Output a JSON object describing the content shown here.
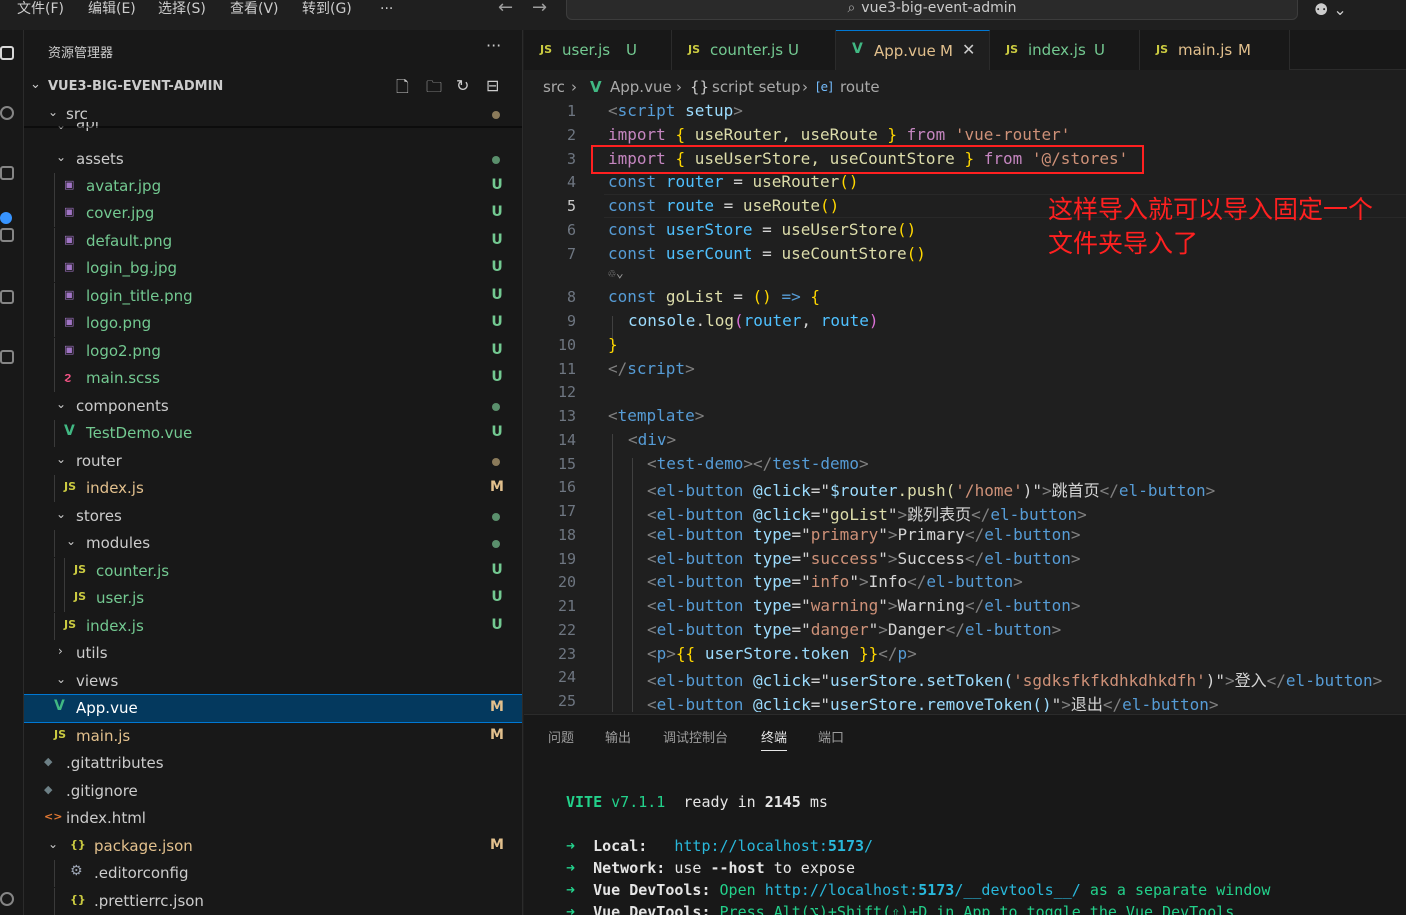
{
  "menu": {
    "file": "文件(F)",
    "edit": "编辑(E)",
    "select": "选择(S)",
    "view": "查看(V)",
    "goto": "转到(G)",
    "more": "···"
  },
  "command_center": {
    "text": "vue3-big-event-admin"
  },
  "sidebar": {
    "title": "资源管理器",
    "more": "···",
    "project": "VUE3-BIG-EVENT-ADMIN",
    "tree": [
      {
        "name": "src",
        "status": ""
      },
      {
        "name": "api",
        "status": ""
      },
      {
        "name": "assets",
        "status": ""
      },
      {
        "name": "avatar.jpg",
        "status": "U"
      },
      {
        "name": "cover.jpg",
        "status": "U"
      },
      {
        "name": "default.png",
        "status": "U"
      },
      {
        "name": "login_bg.jpg",
        "status": "U"
      },
      {
        "name": "login_title.png",
        "status": "U"
      },
      {
        "name": "logo.png",
        "status": "U"
      },
      {
        "name": "logo2.png",
        "status": "U"
      },
      {
        "name": "main.scss",
        "status": "U"
      },
      {
        "name": "components",
        "status": ""
      },
      {
        "name": "TestDemo.vue",
        "status": "U"
      },
      {
        "name": "router",
        "status": ""
      },
      {
        "name": "index.js",
        "status": "M"
      },
      {
        "name": "stores",
        "status": ""
      },
      {
        "name": "modules",
        "status": ""
      },
      {
        "name": "counter.js",
        "status": "U"
      },
      {
        "name": "user.js",
        "status": "U"
      },
      {
        "name": "index.js",
        "status": "U"
      },
      {
        "name": "utils",
        "status": ""
      },
      {
        "name": "views",
        "status": ""
      },
      {
        "name": "App.vue",
        "status": "M"
      },
      {
        "name": "main.js",
        "status": "M"
      },
      {
        "name": ".gitattributes",
        "status": ""
      },
      {
        "name": ".gitignore",
        "status": ""
      },
      {
        "name": "index.html",
        "status": ""
      },
      {
        "name": "package.json",
        "status": "M"
      },
      {
        "name": ".editorconfig",
        "status": ""
      },
      {
        "name": ".prettierrc.json",
        "status": ""
      }
    ]
  },
  "tabs": [
    {
      "label": "user.js",
      "status": "U",
      "icon": "JS"
    },
    {
      "label": "counter.js",
      "status": "U",
      "icon": "JS"
    },
    {
      "label": "App.vue",
      "status": "M",
      "icon": "V"
    },
    {
      "label": "index.js",
      "status": "U",
      "icon": "JS"
    },
    {
      "label": "main.js",
      "status": "M",
      "icon": "JS"
    }
  ],
  "breadcrumb": [
    "src",
    "App.vue",
    "script setup",
    "route"
  ],
  "breadcrumb_icons": {
    "vue": "V",
    "braces": "{}",
    "var": "[e]"
  },
  "editor": {
    "line_numbers": [
      "1",
      "2",
      "3",
      "4",
      "5",
      "6",
      "7",
      "8",
      "9",
      "10",
      "11",
      "12",
      "13",
      "14",
      "15",
      "16",
      "17",
      "18",
      "19",
      "20",
      "21",
      "22",
      "23",
      "24",
      "25"
    ],
    "annotation_line1": "这样导入就可以导入固定一个",
    "annotation_line2": "文件夹导入了",
    "code": {
      "l1_script": "script",
      "l1_setup": "setup",
      "import": "import",
      "from": "from",
      "const": "const",
      "l2_names": "useRouter, useRoute",
      "l2_src": "'vue-router'",
      "l3_names": "useUserStore, useCountStore",
      "l3_src": "'@/stores'",
      "router": "router",
      "route": "route",
      "useRouter": "useRouter",
      "useRoute": "useRoute",
      "userStore": "userStore",
      "userCount": "userCount",
      "useUserStore": "useUserStore",
      "useCountStore": "useCountStore",
      "goList": "goList",
      "console": "console",
      "log": "log",
      "template": "template",
      "div": "div",
      "test_demo": "test-demo",
      "el_button": "el-button",
      "p": "p",
      "click": "@click",
      "type": "type",
      "l16_expr_a": "$router",
      "l16_expr_b": ".push(",
      "l16_expr_path": "'/home'",
      "l16_text": "跳首页",
      "l17_expr": "goList",
      "l17_text": "跳列表页",
      "t_primary": "primary",
      "t_success": "success",
      "t_info": "info",
      "t_warning": "warning",
      "t_danger": "danger",
      "x_primary": "Primary",
      "x_success": "Success",
      "x_info": "Info",
      "x_warning": "Warning",
      "x_danger": "Danger",
      "l23_expr": "userStore.token",
      "l24_expr_a": "userStore.setToken(",
      "l24_expr_tok": "'sgdksfkfkdhkdhkdfh'",
      "l24_text": "登入",
      "l25_expr": "userStore.removeToken()",
      "l25_text": "退出"
    }
  },
  "panel": {
    "tabs": [
      "问题",
      "输出",
      "调试控制台",
      "终端",
      "端口"
    ],
    "active_tab": "终端",
    "terminal": {
      "vite": "VITE",
      "version": "v7.1.1",
      "ready": "ready in",
      "ms_value": "2145",
      "ms": "ms",
      "arrow": "➜",
      "local_label": "Local:",
      "local_url_a": "http://localhost:",
      "local_port": "5173",
      "local_url_b": "/",
      "network_label": "Network:",
      "network_a": "use",
      "network_flag": "--host",
      "network_b": "to expose",
      "devtools_label": "Vue DevTools:",
      "devtools_open": "Open",
      "devtools_url_a": "http://localhost:",
      "devtools_port": "5173",
      "devtools_url_b": "/__devtools__/",
      "devtools_tail": "as a separate window",
      "devtools2_text": "Press Alt(⌥)+Shift(⇧)+D in App to toggle the Vue DevTools"
    }
  },
  "colors": {
    "accent": "#0078d4",
    "annotation": "#ff2020",
    "untracked": "#73c991",
    "modified": "#e2c08d"
  }
}
